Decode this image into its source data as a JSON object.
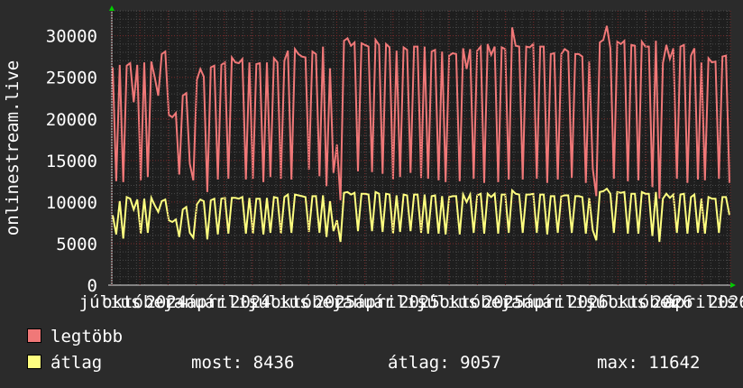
{
  "chart_data": {
    "type": "line",
    "ylabel": "onlinestream.live",
    "ylim": [
      0,
      33000
    ],
    "yticks": [
      0,
      5000,
      10000,
      15000,
      20000,
      25000,
      30000
    ],
    "x_tick_labels": [
      "július",
      "október",
      "2024",
      "január",
      "április",
      "2024",
      "július",
      "október",
      "2025",
      "január",
      "április",
      "2025",
      "július",
      "október",
      "2025",
      "január",
      "április",
      "2026",
      "július",
      "október",
      "2026",
      "április",
      "2026"
    ],
    "grid": true,
    "series": [
      {
        "name": "legtöbb",
        "color": "#f07878",
        "values": [
          26200,
          12500,
          26500,
          12400,
          26400,
          26700,
          22000,
          26500,
          12600,
          26800,
          13000,
          26900,
          25000,
          22800,
          27800,
          28100,
          20500,
          20200,
          20700,
          13300,
          22800,
          23100,
          14600,
          12600,
          24700,
          26000,
          25100,
          11200,
          26200,
          26400,
          12700,
          26500,
          26800,
          12800,
          27400,
          26800,
          26700,
          27200,
          12700,
          26800,
          12800,
          26600,
          26700,
          12400,
          26800,
          13000,
          27300,
          26800,
          12800,
          27000,
          28200,
          12700,
          28400,
          27800,
          27500,
          27400,
          13900,
          28100,
          27800,
          13100,
          28700,
          11900,
          26100,
          13500,
          16900,
          10200,
          29400,
          29700,
          28800,
          29200,
          13700,
          29100,
          28900,
          28700,
          13600,
          29500,
          28900,
          13400,
          29000,
          28600,
          12700,
          28200,
          13000,
          28600,
          28300,
          13500,
          28700,
          28700,
          12900,
          28700,
          12800,
          28100,
          28300,
          12600,
          28100,
          12400,
          27600,
          27900,
          27800,
          12500,
          28500,
          26000,
          28400,
          12800,
          28200,
          28700,
          12300,
          29000,
          27700,
          28700,
          12400,
          28600,
          28400,
          12700,
          31000,
          28800,
          28700,
          12700,
          28700,
          28600,
          29000,
          12800,
          28700,
          28700,
          12300,
          27800,
          27900,
          12700,
          27800,
          28400,
          28100,
          12900,
          27800,
          27800,
          27500,
          12300,
          26900,
          14000,
          10700,
          29200,
          29500,
          31200,
          28500,
          12800,
          29300,
          29000,
          29400,
          12500,
          28900,
          28800,
          12600,
          29300,
          28700,
          28700,
          11800,
          29400,
          10400,
          26700,
          28900,
          27200,
          28500,
          12800,
          28700,
          28900,
          12300,
          27600,
          28500,
          12700,
          26800,
          12600,
          27300,
          26800,
          26900,
          12800,
          27500,
          27600,
          12300
        ],
        "values_max": 31500
      },
      {
        "name": "átlag",
        "color": "#ffff80",
        "values": [
          8400,
          6100,
          10100,
          5600,
          10600,
          10400,
          9100,
          10300,
          6200,
          10400,
          6300,
          10500,
          9600,
          8800,
          10100,
          10300,
          7800,
          7600,
          7900,
          5800,
          9100,
          9400,
          6300,
          5700,
          9700,
          10300,
          10100,
          5500,
          10200,
          10400,
          6100,
          10400,
          10500,
          6200,
          10500,
          10500,
          10400,
          10600,
          6200,
          10500,
          6200,
          10400,
          10400,
          6100,
          10500,
          6300,
          10600,
          10500,
          6200,
          10600,
          10900,
          6300,
          10900,
          10800,
          10700,
          10600,
          6400,
          10700,
          10700,
          6300,
          10800,
          5800,
          10100,
          6500,
          7800,
          5200,
          11100,
          11200,
          10900,
          11100,
          6500,
          11000,
          11000,
          10900,
          6500,
          11200,
          11000,
          6400,
          11000,
          10900,
          6200,
          10800,
          6400,
          10900,
          10800,
          6500,
          10900,
          10900,
          6300,
          10900,
          6200,
          10700,
          10800,
          6200,
          10700,
          6100,
          10600,
          10700,
          10700,
          6100,
          10900,
          10000,
          10900,
          6300,
          10800,
          11000,
          6200,
          11000,
          10600,
          11000,
          6200,
          10900,
          10900,
          6300,
          11400,
          11000,
          10900,
          6300,
          10900,
          10900,
          11000,
          6300,
          10900,
          10900,
          6100,
          10700,
          10700,
          6300,
          10700,
          10800,
          10800,
          6300,
          10700,
          10700,
          10600,
          6200,
          10500,
          6600,
          5400,
          11200,
          11300,
          11600,
          11000,
          6300,
          11200,
          11100,
          11200,
          6200,
          11000,
          11000,
          6200,
          11200,
          11000,
          11000,
          5900,
          11200,
          5200,
          10400,
          11000,
          10500,
          10900,
          6300,
          10900,
          11000,
          6200,
          10600,
          10900,
          6300,
          10400,
          6200,
          10600,
          10400,
          10400,
          6300,
          10600,
          10600,
          8436
        ]
      }
    ]
  },
  "legend": [
    {
      "name": "legtöbb",
      "color": "#f07878"
    },
    {
      "name": "átlag",
      "color": "#ffff80"
    }
  ],
  "stats": {
    "most_label": "most:",
    "most_value": "8436",
    "atlag_label": "átlag:",
    "atlag_value": "9057",
    "max_label": "max:",
    "max_value": "11642"
  },
  "colors": {
    "background": "#2b2b2b",
    "plot_background": "#1e1e1e",
    "grid_minor": "#4a4a4a",
    "grid_major": "#7a2a2a",
    "axis_text": "#ffffff",
    "axis_arrow": "#00cc00"
  }
}
